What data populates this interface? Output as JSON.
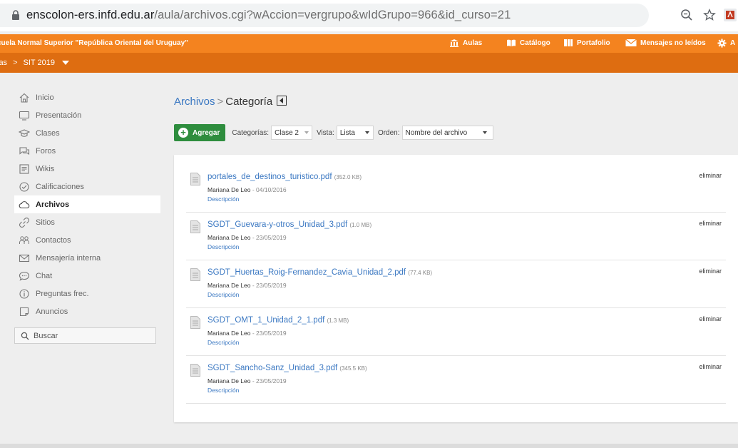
{
  "browser": {
    "url_host": "enscolon-ers.infd.edu.ar",
    "url_path": "/aula/archivos.cgi?wAccion=vergrupo&wIdGrupo=966&id_curso=21"
  },
  "site": {
    "name": "cuela Normal Superior \"República Oriental del Uruguay\"",
    "nav": [
      {
        "label": "Aulas",
        "icon": "building-icon"
      },
      {
        "label": "Catálogo",
        "icon": "book-icon"
      },
      {
        "label": "Portafolio",
        "icon": "portfolio-icon"
      },
      {
        "label": "Mensajes no leídos",
        "icon": "envelope-icon"
      },
      {
        "label": "A",
        "icon": "gear-icon"
      }
    ],
    "breadcrumb": {
      "root": "las",
      "current": "SIT 2019"
    }
  },
  "sidebar": {
    "items": [
      {
        "label": "Inicio"
      },
      {
        "label": "Presentación"
      },
      {
        "label": "Clases"
      },
      {
        "label": "Foros"
      },
      {
        "label": "Wikis"
      },
      {
        "label": "Calificaciones"
      },
      {
        "label": "Archivos",
        "active": true
      },
      {
        "label": "Sitios"
      },
      {
        "label": "Contactos"
      },
      {
        "label": "Mensajería interna"
      },
      {
        "label": "Chat"
      },
      {
        "label": "Preguntas frec."
      },
      {
        "label": "Anuncios"
      }
    ],
    "search_label": "Buscar"
  },
  "main": {
    "title_root": "Archivos",
    "title_sep": ">",
    "title_current": "Categoría",
    "toolbar": {
      "add_label": "Agregar",
      "categories_label": "Categorías:",
      "categories_value": "Clase 2",
      "view_label": "Vista:",
      "view_value": "Lista",
      "order_label": "Orden:",
      "order_value": "Nombre del archivo"
    },
    "files": [
      {
        "name": "portales_de_destinos_turistico.pdf",
        "size": "(352.0 KB)",
        "author": "Mariana De Leo",
        "date": "- 04/10/2016",
        "desc": "Descripción",
        "delete": "eliminar"
      },
      {
        "name": "SGDT_Guevara-y-otros_Unidad_3.pdf",
        "size": "(1.0 MB)",
        "author": "Mariana De Leo",
        "date": "- 23/05/2019",
        "desc": "Descripción",
        "delete": "eliminar"
      },
      {
        "name": "SGDT_Huertas_Roig-Fernandez_Cavia_Unidad_2.pdf",
        "size": "(77.4 KB)",
        "author": "Mariana De Leo",
        "date": "- 23/05/2019",
        "desc": "Descripción",
        "delete": "eliminar"
      },
      {
        "name": "SGDT_OMT_1_Unidad_2_1.pdf",
        "size": "(1.3 MB)",
        "author": "Mariana De Leo",
        "date": "- 23/05/2019",
        "desc": "Descripción",
        "delete": "eliminar"
      },
      {
        "name": "SGDT_Sancho-Sanz_Unidad_3.pdf",
        "size": "(345.5 KB)",
        "author": "Mariana De Leo",
        "date": "- 23/05/2019",
        "desc": "Descripción",
        "delete": "eliminar"
      }
    ]
  },
  "colors": {
    "accent": "#f4831f",
    "accent_dark": "#de6d11",
    "link": "#3b78c2",
    "add_button": "#2e8d3e"
  }
}
